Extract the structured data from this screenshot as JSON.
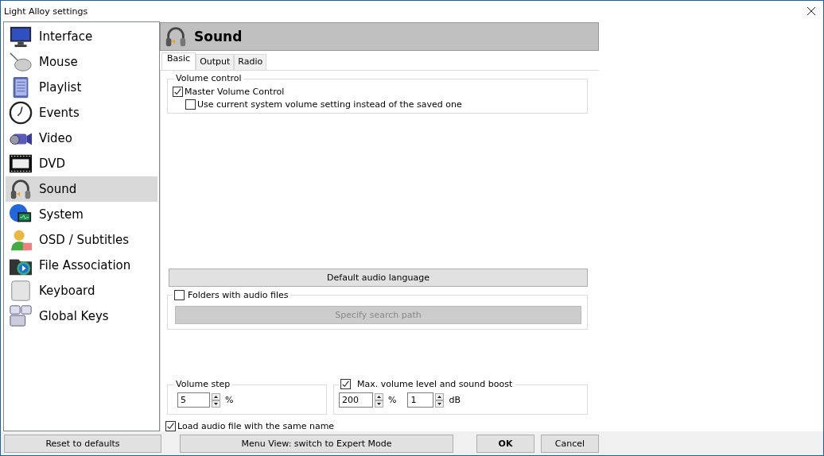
{
  "window": {
    "title": "Light Alloy settings"
  },
  "sidebar": {
    "items": [
      {
        "label": "Interface",
        "selected": false
      },
      {
        "label": "Mouse",
        "selected": false
      },
      {
        "label": "Playlist",
        "selected": false
      },
      {
        "label": "Events",
        "selected": false
      },
      {
        "label": "Video",
        "selected": false
      },
      {
        "label": "DVD",
        "selected": false
      },
      {
        "label": "Sound",
        "selected": true
      },
      {
        "label": "System",
        "selected": false
      },
      {
        "label": "OSD / Subtitles",
        "selected": false
      },
      {
        "label": "File Association",
        "selected": false
      },
      {
        "label": "Keyboard",
        "selected": false
      },
      {
        "label": "Global Keys",
        "selected": false
      }
    ]
  },
  "panel": {
    "title": "Sound",
    "tabs": [
      {
        "label": "Basic",
        "selected": true
      },
      {
        "label": "Output",
        "selected": false
      },
      {
        "label": "Radio",
        "selected": false
      }
    ],
    "volume_control": {
      "legend": "Volume control",
      "options": [
        {
          "label": "Master Volume Control",
          "checked": true
        },
        {
          "label": "Use current system volume setting instead of the saved one",
          "checked": false
        }
      ]
    },
    "default_audio_language_button": {
      "label": "Default audio language"
    },
    "folders": {
      "label": "Folders with audio files",
      "checked": false,
      "button": {
        "label": "Specify search path",
        "disabled": true
      }
    },
    "volume_step": {
      "legend": "Volume step",
      "value": "5",
      "unit": "%"
    },
    "max_volume": {
      "label": "Max. volume level and sound boost",
      "checked": true,
      "fields": [
        {
          "value": "200",
          "unit": "%"
        },
        {
          "value": "1",
          "unit": "dB"
        }
      ]
    },
    "load_same_name": {
      "label": "Load audio file with the same name",
      "checked": true
    }
  },
  "footer": {
    "reset": "Reset to defaults",
    "menu_view": "Menu View: switch to Expert Mode",
    "ok": "OK",
    "cancel": "Cancel"
  }
}
